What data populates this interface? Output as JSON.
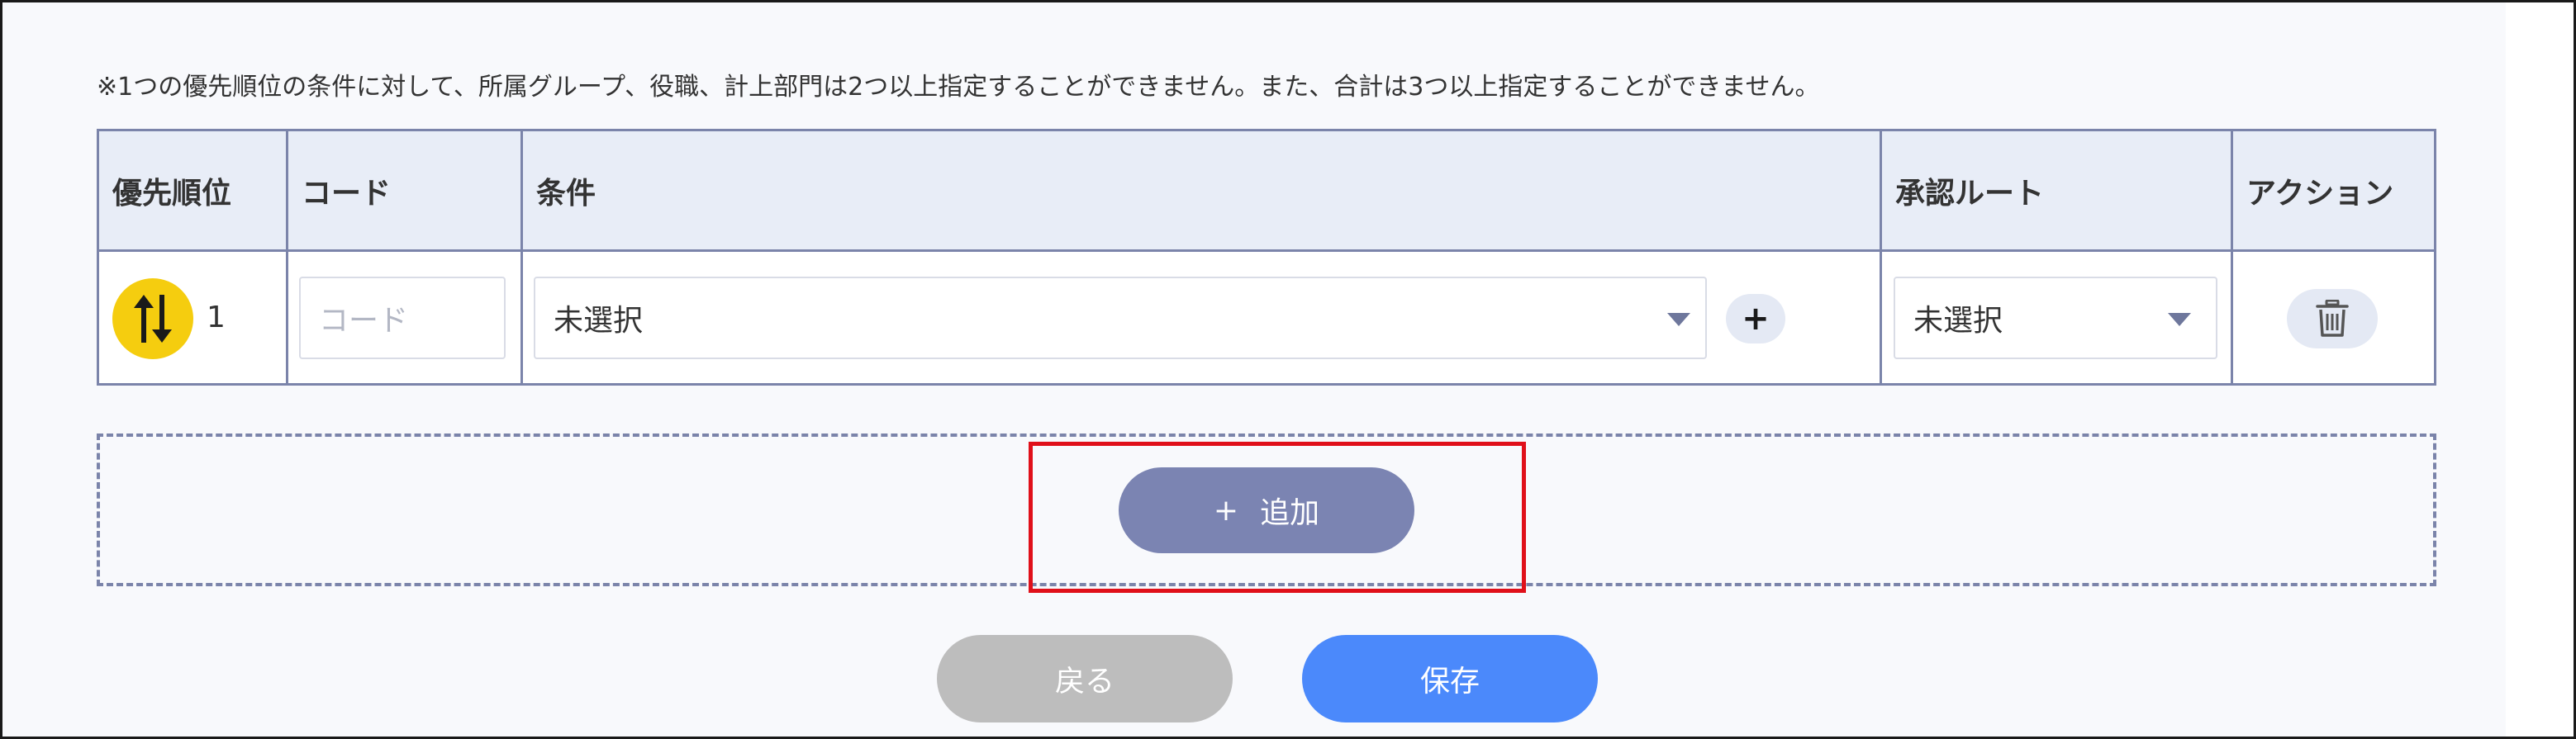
{
  "notice": "※1つの優先順位の条件に対して、所属グループ、役職、計上部門は2つ以上指定することができません。また、合計は3つ以上指定することができません。",
  "table": {
    "headers": {
      "priority": "優先順位",
      "code": "コード",
      "condition": "条件",
      "route": "承認ルート",
      "action": "アクション"
    },
    "rows": [
      {
        "priority": "1",
        "code_placeholder": "コード",
        "condition_value": "未選択",
        "route_value": "未選択"
      }
    ]
  },
  "add_button": {
    "icon": "+",
    "label": "追加"
  },
  "buttons": {
    "back": "戻る",
    "save": "保存"
  },
  "colors": {
    "accent": "#4b89fb",
    "priority_icon": "#f5cd0f",
    "add_button": "#7b84b2",
    "highlight": "#e0101a",
    "back_button": "#bdbdbd"
  },
  "icons": {
    "priority": "sort-arrows-icon",
    "add_condition": "plus-icon",
    "delete": "trash-icon",
    "dropdown": "chevron-down-icon"
  }
}
